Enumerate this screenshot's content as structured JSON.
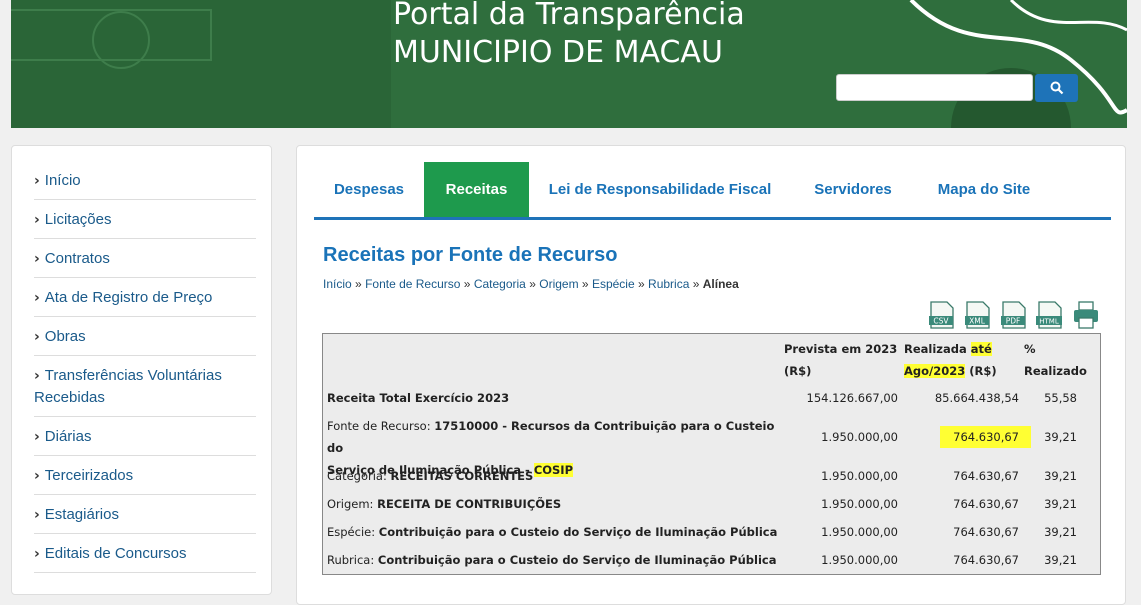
{
  "header": {
    "title_line1": "Portal da Transparência",
    "title_line2": "MUNICIPIO DE MACAU",
    "search_placeholder": ""
  },
  "sidebar": {
    "items": [
      {
        "label": "Início"
      },
      {
        "label": "Licitações"
      },
      {
        "label": "Contratos"
      },
      {
        "label": "Ata de Registro de Preço"
      },
      {
        "label": "Obras"
      },
      {
        "label_1": "Transferências Voluntárias",
        "label_2": "Recebidas"
      },
      {
        "label": "Diárias"
      },
      {
        "label": "Terceirizados"
      },
      {
        "label": "Estagiários"
      },
      {
        "label": "Editais de Concursos"
      }
    ]
  },
  "tabs": [
    {
      "label": "Despesas"
    },
    {
      "label": "Receitas"
    },
    {
      "label": "Lei de Responsabilidade Fiscal"
    },
    {
      "label": "Servidores"
    },
    {
      "label": "Mapa do Site"
    }
  ],
  "page_title": "Receitas por Fonte de Recurso",
  "breadcrumb": [
    "Início",
    "Fonte de Recurso",
    "Categoria",
    "Origem",
    "Espécie",
    "Rubrica",
    "Alínea"
  ],
  "breadcrumb_sep": "»",
  "exports": [
    "CSV",
    "XML",
    "PDF",
    "HTML"
  ],
  "table": {
    "headers": {
      "prevista_1": "Prevista em 2023",
      "prevista_2": "(R$)",
      "realizada_1a": "Realizada ",
      "realizada_1b": "até",
      "realizada_2a": "Ago/2023",
      "realizada_2b": " (R$)",
      "pct_1": "%",
      "pct_2": "Realizado"
    },
    "total": {
      "label": "Receita Total Exercício 2023",
      "prevista": "154.126.667,00",
      "realizada": "85.664.438,54",
      "pct": "55,58"
    },
    "fonte": {
      "prefix": "Fonte de Recurso: ",
      "text_1": "17510000 - Recursos da Contribuição para o Custeio do",
      "text_2a": "Serviço de Iluminação Pública - ",
      "text_2b": "COSIP",
      "prevista": "1.950.000,00",
      "realizada": "764.630,67",
      "pct": "39,21"
    },
    "rows": [
      {
        "prefix": "Categoria: ",
        "text": "RECEITAS CORRENTES",
        "prevista": "1.950.000,00",
        "realizada": "764.630,67",
        "pct": "39,21"
      },
      {
        "prefix": "Origem: ",
        "text": "RECEITA DE CONTRIBUIÇÕES",
        "prevista": "1.950.000,00",
        "realizada": "764.630,67",
        "pct": "39,21"
      },
      {
        "prefix": "Espécie: ",
        "text": "Contribuição para o Custeio do Serviço de Iluminação Pública",
        "prevista": "1.950.000,00",
        "realizada": "764.630,67",
        "pct": "39,21"
      },
      {
        "prefix": "Rubrica: ",
        "text": "Contribuição para o Custeio do Serviço de Iluminação Pública",
        "prevista": "1.950.000,00",
        "realizada": "764.630,67",
        "pct": "39,21"
      }
    ]
  },
  "colors": {
    "banner": "#2e6b3c",
    "accent_blue": "#1e73b8",
    "active_tab": "#1e9a4d",
    "highlight": "#ffff33"
  }
}
